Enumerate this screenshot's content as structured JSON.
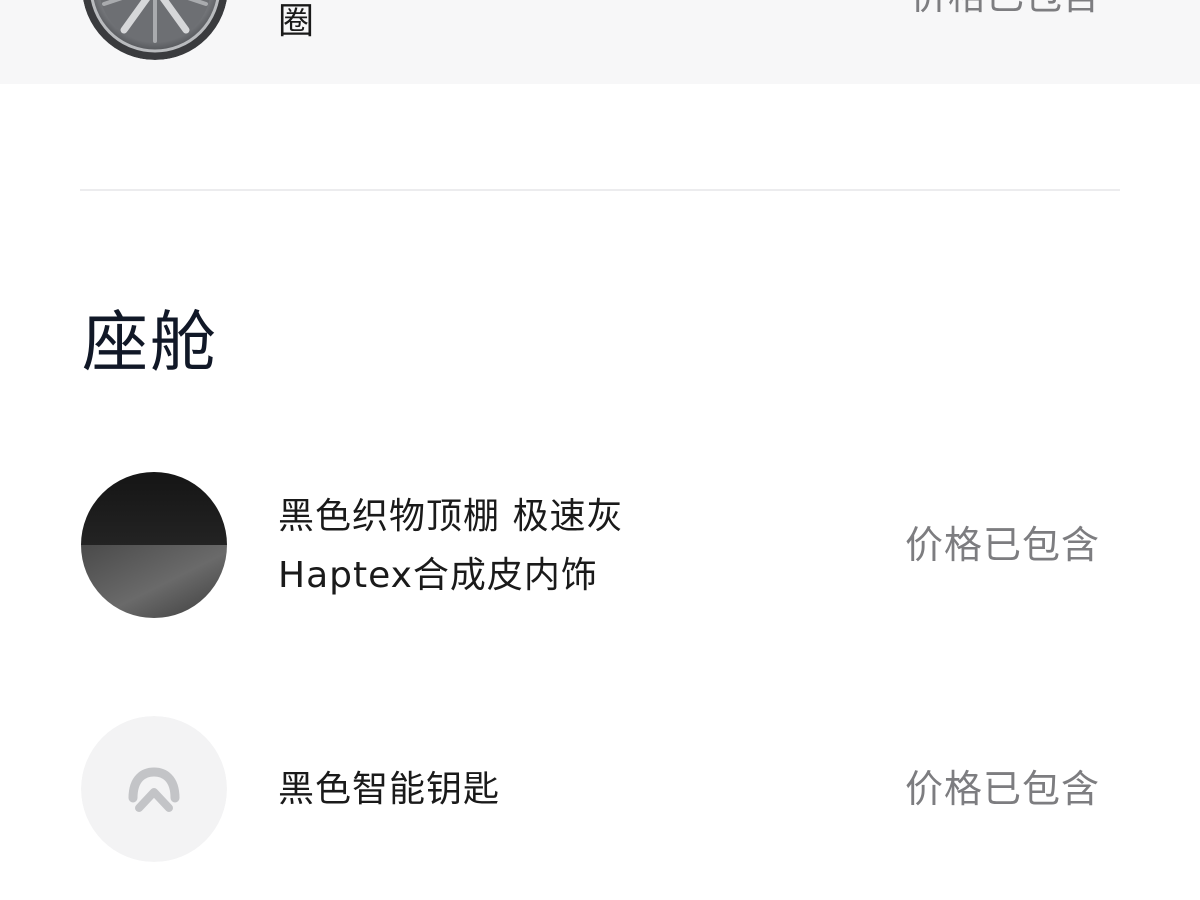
{
  "wheel_option": {
    "label_tail": "圈",
    "price": "价格已包含",
    "icon": "alloy-wheel-icon"
  },
  "cabin_section": {
    "title": "座舱",
    "items": [
      {
        "label_line1": "黑色织物顶棚 极速灰",
        "label_line2": "Haptex合成皮内饰",
        "price": "价格已包含",
        "icon": "interior-color-swatch-icon"
      },
      {
        "label_line1": "黑色智能钥匙",
        "price": "价格已包含",
        "icon": "nio-logo-icon"
      }
    ]
  },
  "colors": {
    "background": "#ffffff",
    "row_highlight": "#f7f7f8",
    "title_text": "#111827",
    "body_text": "#1a1a1a",
    "price_text": "#7d7d80",
    "divider": "#ececee"
  }
}
